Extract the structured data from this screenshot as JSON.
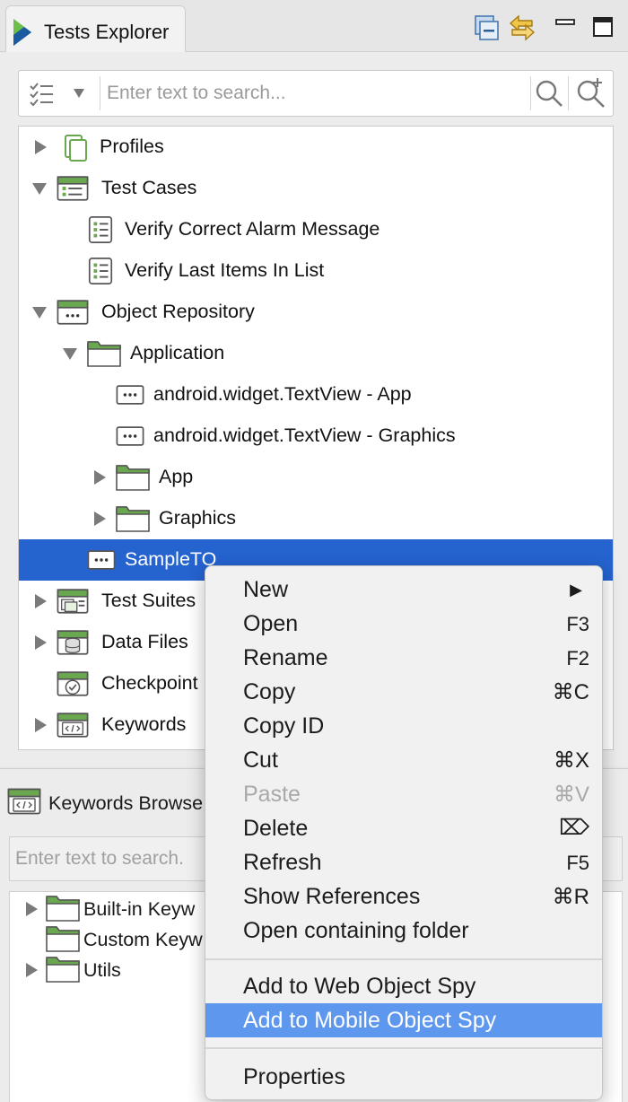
{
  "explorer": {
    "tab_title": "Tests Explorer",
    "search_placeholder": "Enter text to search...",
    "tree": {
      "profiles": "Profiles",
      "test_cases": "Test Cases",
      "tc_alarm": "Verify Correct Alarm Message",
      "tc_items": "Verify Last Items In List",
      "object_repository": "Object Repository",
      "application": "Application",
      "textview_app": "android.widget.TextView - App",
      "textview_graphics": "android.widget.TextView - Graphics",
      "app": "App",
      "graphics": "Graphics",
      "sample_to": "SampleTO",
      "test_suites": "Test Suites",
      "data_files": "Data Files",
      "checkpoints": "Checkpoint",
      "keywords": "Keywords"
    }
  },
  "keywords_browser": {
    "title": "Keywords Browse",
    "search_placeholder": "Enter text to search.",
    "items": [
      "Built-in Keyw",
      "Custom Keyw",
      "Utils"
    ]
  },
  "context_menu": {
    "items": [
      {
        "label": "New",
        "shortcut": "▶"
      },
      {
        "label": "Open",
        "shortcut": "F3"
      },
      {
        "label": "Rename",
        "shortcut": "F2"
      },
      {
        "label": "Copy",
        "shortcut": "⌘C"
      },
      {
        "label": "Copy ID",
        "shortcut": ""
      },
      {
        "label": "Cut",
        "shortcut": "⌘X"
      },
      {
        "label": "Paste",
        "shortcut": "⌘V"
      },
      {
        "label": "Delete",
        "shortcut": "⌦"
      },
      {
        "label": "Refresh",
        "shortcut": "F5"
      },
      {
        "label": "Show References",
        "shortcut": "⌘R"
      },
      {
        "label": "Open containing folder",
        "shortcut": ""
      },
      {
        "label": "Add to Web Object Spy",
        "shortcut": ""
      },
      {
        "label": "Add to Mobile Object Spy",
        "shortcut": ""
      },
      {
        "label": "Properties",
        "shortcut": ""
      }
    ]
  },
  "colors": {
    "selection": "#2563cf",
    "menu_highlight": "#5e97ee",
    "folder_green": "#6aa84f"
  }
}
